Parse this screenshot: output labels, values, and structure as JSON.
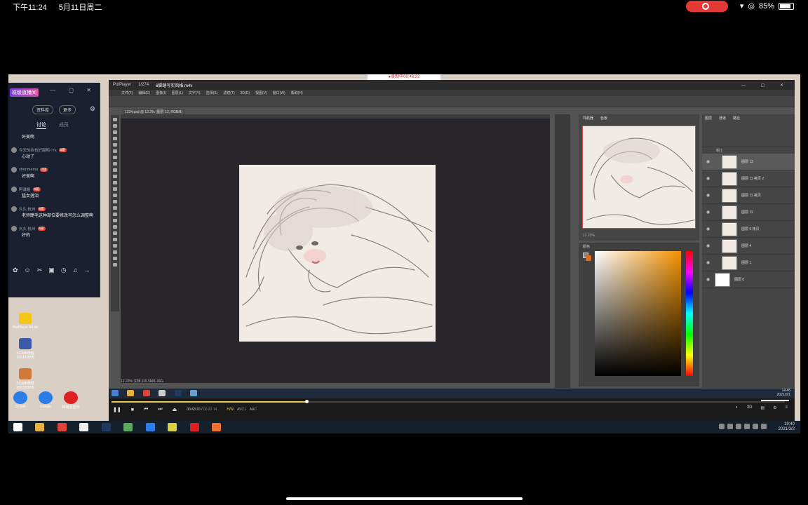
{
  "status_bar": {
    "time": "下午11:24",
    "date": "5月11日周二",
    "battery": "85%",
    "battery_level": 0.85
  },
  "recording_tag": "●录制中00:46:22",
  "chat": {
    "title": "班级直播间",
    "buttons": [
      "资料库",
      "更多"
    ],
    "tabs": [
      "讨论",
      "成员"
    ],
    "messages": [
      {
        "user": "",
        "badge": "",
        "text": "好美啊"
      },
      {
        "user": "今天的你也好甜鸭~Yx",
        "badge": "5级",
        "text": "心动了"
      },
      {
        "user": "shenmema",
        "badge": "5级",
        "text": "好美啊"
      },
      {
        "user": "阿滋姐",
        "badge": "5级",
        "text": "猛女落泪"
      },
      {
        "user": "久久 杭州",
        "badge": "5级",
        "text": "老师睫毛这种部位要修改可怎么调整啊"
      },
      {
        "user": "久久 杭州",
        "badge": "5级",
        "text": "好的"
      }
    ]
  },
  "desktop_icons": [
    {
      "label": "PotPlayer 64 bit",
      "color": "#f5c518"
    },
    {
      "label": "CCtalk课程 2021/03/06",
      "color": "#3a5ba8"
    },
    {
      "label": "CCtalk课程 2021/03/06",
      "color": "#d07a3a"
    }
  ],
  "bottom_icons": [
    {
      "label": "CCtalk",
      "color": "#2b7de9"
    },
    {
      "label": "Google",
      "color": "#2b7de9"
    },
    {
      "label": "网易云音乐",
      "color": "#e02020"
    }
  ],
  "potplayer": {
    "logo": "PotPlayer",
    "tab": "1/274",
    "filename": "6脚踏写实风格.m4v",
    "elapsed": "00:43:20",
    "duration": "00:22:14",
    "progress": 0.29,
    "codecs": [
      "H/W",
      "AVC1",
      "AAC"
    ]
  },
  "photoshop": {
    "menu": [
      "文件(F)",
      "编辑(E)",
      "图像(I)",
      "图层(L)",
      "文字(Y)",
      "选择(S)",
      "滤镜(T)",
      "3D(D)",
      "视图(V)",
      "窗口(W)",
      "帮助(H)"
    ],
    "doc_tab": "1234.psd @ 12.2% (图层 13, RGB/8)",
    "status": "12.22%   文档:115.5M/1.06G",
    "nav_tabs": [
      "导航器",
      "色板"
    ],
    "nav_zoom": "12.22%",
    "color_title": "颜色",
    "layer_tabs": [
      "图层",
      "通道",
      "路径"
    ],
    "group_name": "组 1",
    "layers": [
      {
        "name": "图层 13",
        "selected": true
      },
      {
        "name": "图层 11 拷贝 2",
        "selected": false
      },
      {
        "name": "图层 11 拷贝",
        "selected": false
      },
      {
        "name": "图层 11",
        "selected": false
      },
      {
        "name": "图层 6 拷贝",
        "selected": false
      },
      {
        "name": "图层 4",
        "selected": false
      },
      {
        "name": "图层 1",
        "selected": false
      }
    ],
    "background_layer": "图层 0"
  },
  "inner_clock": {
    "time": "14:46",
    "date": "2021/3/1"
  },
  "outer_clock": {
    "time": "19:40",
    "date": "2021/3/2"
  }
}
